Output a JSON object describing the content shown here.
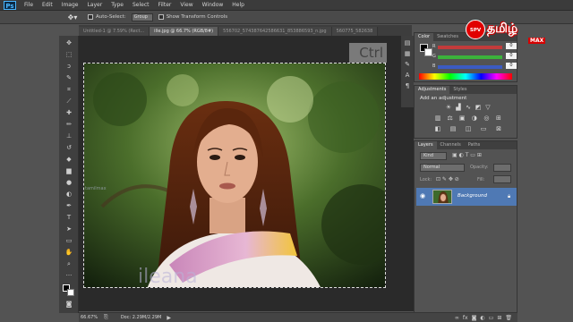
{
  "app": {
    "logo_text": "Ps"
  },
  "menubar": {
    "items": [
      "File",
      "Edit",
      "Image",
      "Layer",
      "Type",
      "Select",
      "Filter",
      "View",
      "Window",
      "Help"
    ]
  },
  "options": {
    "auto_select_label": "Auto-Select:",
    "auto_select_value": "Group",
    "show_transform_label": "Show Transform Controls"
  },
  "tabs": [
    {
      "label": "Untitled-1 @ 7.59% (Rect...",
      "active": false
    },
    {
      "label": "ille.jpg @ 66.7% (RGB/8#)",
      "active": true
    },
    {
      "label": "556702_574387642586631_853886593_n.jpg",
      "active": false
    },
    {
      "label": "560775_582638",
      "active": false
    }
  ],
  "canvas": {
    "overlay_text": "Ctrl",
    "watermark": "tamilmax",
    "photo_caption": "ileana"
  },
  "status": {
    "zoom": "66.67%",
    "doc_size": "Doc: 2.29M/2.29M"
  },
  "color_panel": {
    "tabs": [
      "Color",
      "Swatches"
    ],
    "sliders": [
      {
        "label": "R",
        "value": "0",
        "color": "#c23b3b"
      },
      {
        "label": "G",
        "value": "0",
        "color": "#3bb33b"
      },
      {
        "label": "B",
        "value": "0",
        "color": "#3b5bc2"
      }
    ]
  },
  "adjustments_panel": {
    "tabs": [
      "Adjustments",
      "Styles"
    ],
    "title": "Add an adjustment",
    "icons_row1": [
      "brightness-icon",
      "levels-icon",
      "curves-icon",
      "exposure-icon"
    ],
    "icons_row2": [
      "vibrance-icon",
      "hue-saturation-icon",
      "color-balance-icon",
      "black-white-icon",
      "photo-filter-icon",
      "channel-mixer-icon",
      "color-lookup-icon"
    ],
    "icons_row3": [
      "invert-icon",
      "posterize-icon",
      "threshold-icon",
      "gradient-map-icon",
      "selective-color-icon"
    ]
  },
  "layers_panel": {
    "tabs": [
      "Layers",
      "Channels",
      "Paths"
    ],
    "kind_label": "Kind",
    "blend_mode": "Normal",
    "opacity_label": "Opacity:",
    "lock_label": "Lock:",
    "fill_label": "Fill:",
    "layer_name": "Background"
  },
  "brand": {
    "badge": "SPV",
    "main": "தமிழ்",
    "sub": "MAX"
  }
}
